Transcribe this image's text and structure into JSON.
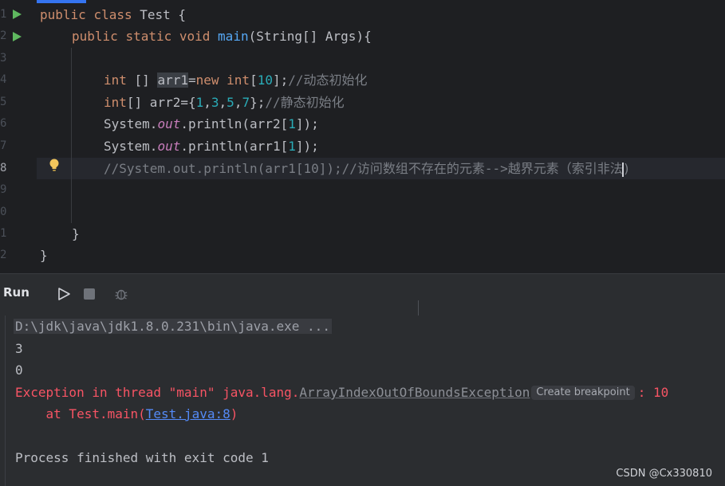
{
  "editor": {
    "line_numbers": [
      "1",
      "2",
      "3",
      "4",
      "5",
      "6",
      "7",
      "8",
      "9",
      "0",
      "1",
      "2"
    ],
    "lines": {
      "l1": {
        "kw1": "public",
        "kw2": "class",
        "rest": " Test {"
      },
      "l2": {
        "kw1": "public",
        "kw2": "static",
        "kw3": "void",
        "fn": "main",
        "rest": "(String[] Args){"
      },
      "l4": {
        "kw1": "int",
        "t1": " [] ",
        "var": "arr1",
        "op": "=",
        "kw2": "new",
        "sp": " ",
        "kw3": "int",
        "b1": "[",
        "n1": "10",
        "b2": "];",
        "cmt": "//动态初始化"
      },
      "l5": {
        "kw1": "int",
        "t1": "[] arr2={",
        "n1": "1",
        "c1": ",",
        "n2": "3",
        "c2": ",",
        "n3": "5",
        "c3": ",",
        "n4": "7",
        "t2": "};",
        "cmt": "//静态初始化"
      },
      "l6": {
        "cls": "System.",
        "fld": "out",
        "rest": ".println(arr2[",
        "n": "1",
        "end": "]);"
      },
      "l7": {
        "cls": "System.",
        "fld": "out",
        "rest": ".println(arr1[",
        "n": "1",
        "end": "]);"
      },
      "l8": {
        "cmt_a": "//System.out.println(arr1[10]);//访问数组不存在的元素-->越界元素（索引非法",
        "cmt_b": ")"
      },
      "l11": {
        "text": "}"
      },
      "l12": {
        "text": "}"
      }
    }
  },
  "run_panel": {
    "title": "Run",
    "icons": [
      "play-icon",
      "stop-icon",
      "debug-icon"
    ]
  },
  "console": {
    "cmd": "D:\\jdk\\java\\jdk1.8.0.231\\bin\\java.exe ...",
    "out1": "3",
    "out2": "0",
    "exc_prefix": "Exception in thread \"main\" java.lang.",
    "exc_class": "ArrayIndexOutOfBoundsException",
    "create_breakpoint": "Create breakpoint",
    "exc_suffix": ": 10",
    "at_prefix": "    at Test.main(",
    "at_link": "Test.java:8",
    "at_suffix": ")",
    "finished": "Process finished with exit code 1"
  },
  "watermark": "CSDN @Cx330810",
  "colors": {
    "accent": "#3574f0",
    "run_green": "#5fb85f",
    "error": "#f75464",
    "link": "#548af7",
    "bulb": "#f2c55c"
  }
}
